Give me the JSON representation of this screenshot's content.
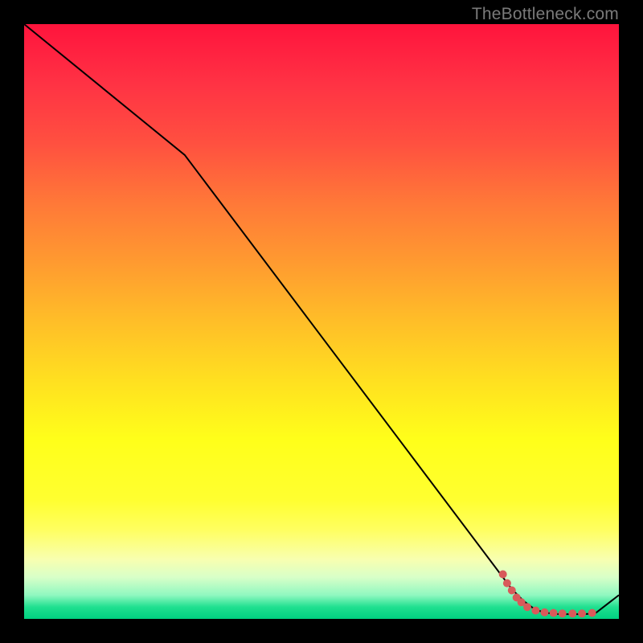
{
  "watermark": "TheBottleneck.com",
  "chart_data": {
    "type": "line",
    "title": "",
    "xlabel": "",
    "ylabel": "",
    "xlim": [
      0,
      100
    ],
    "ylim": [
      0,
      100
    ],
    "series": [
      {
        "name": "main-curve",
        "x": [
          0,
          27,
          82,
          84,
          86,
          88,
          90,
          92,
          94,
          96,
          100
        ],
        "y": [
          100,
          78,
          5,
          3,
          1.5,
          1,
          0.8,
          0.8,
          0.8,
          0.9,
          4
        ]
      }
    ],
    "markers": {
      "name": "dotted-segment",
      "points": [
        {
          "x": 80.5,
          "y": 7.5
        },
        {
          "x": 81.2,
          "y": 6.0
        },
        {
          "x": 82.0,
          "y": 4.8
        },
        {
          "x": 82.8,
          "y": 3.6
        },
        {
          "x": 83.6,
          "y": 2.8
        },
        {
          "x": 84.6,
          "y": 2.0
        },
        {
          "x": 86.0,
          "y": 1.4
        },
        {
          "x": 87.5,
          "y": 1.1
        },
        {
          "x": 89.0,
          "y": 1.0
        },
        {
          "x": 90.5,
          "y": 0.9
        },
        {
          "x": 92.2,
          "y": 0.9
        },
        {
          "x": 93.8,
          "y": 0.9
        },
        {
          "x": 95.5,
          "y": 1.0
        }
      ],
      "color": "#d85a5a",
      "radius": 5
    },
    "colors": {
      "line": "#000000",
      "background_top": "#ff143c",
      "background_bottom": "#00d080"
    }
  }
}
